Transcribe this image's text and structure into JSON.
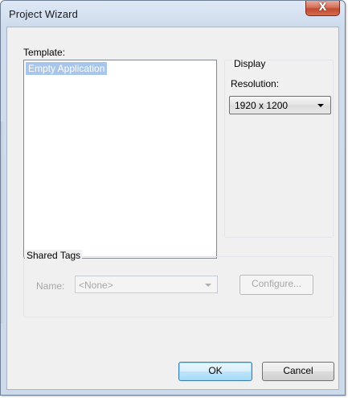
{
  "window": {
    "title": "Project Wizard",
    "close_glyph": "X"
  },
  "template": {
    "label": "Template:",
    "items": [
      "Empty Application"
    ],
    "selected_index": 0
  },
  "display": {
    "group_title": "Display",
    "resolution_label": "Resolution:",
    "resolution_value": "1920 x 1200"
  },
  "shared_tags": {
    "group_title": "Shared Tags",
    "name_label": "Name:",
    "name_value": "<None>",
    "configure_label": "Configure..."
  },
  "buttons": {
    "ok_label": "OK",
    "cancel_label": "Cancel"
  },
  "icons": {
    "close": "close-icon",
    "dropdown": "chevron-down-icon"
  }
}
